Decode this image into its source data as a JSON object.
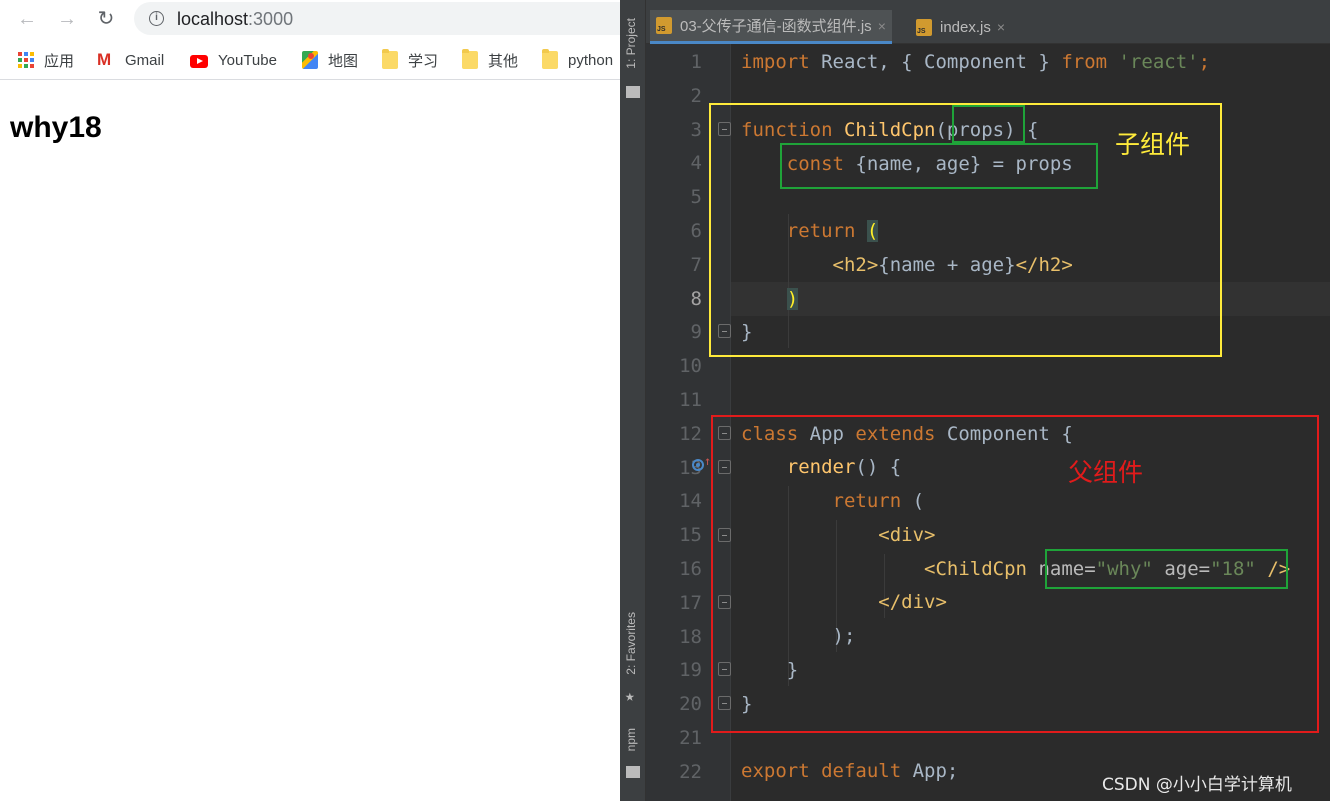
{
  "browser": {
    "nav": {
      "back_icon": "←",
      "forward_icon": "→",
      "reload_icon": "↻"
    },
    "address": {
      "host": "localhost",
      "port": ":3000"
    },
    "bookmarks": [
      {
        "label": "应用",
        "icon": "apps-icon"
      },
      {
        "label": "Gmail",
        "icon": "gmail-icon"
      },
      {
        "label": "YouTube",
        "icon": "youtube-icon"
      },
      {
        "label": "地图",
        "icon": "maps-icon"
      },
      {
        "label": "学习",
        "icon": "folder-icon"
      },
      {
        "label": "其他",
        "icon": "folder-icon"
      },
      {
        "label": "python",
        "icon": "folder-icon"
      }
    ],
    "page_heading": "why18"
  },
  "ide": {
    "tool_windows": {
      "project": "1: Project",
      "favorites": "2: Favorites",
      "npm": "npm"
    },
    "tabs": [
      {
        "label": "03-父传子通信-函数式组件.js",
        "close": "×",
        "active": true
      },
      {
        "label": "index.js",
        "close": "×",
        "active": false
      }
    ],
    "current_line": 8,
    "line_numbers": [
      "1",
      "2",
      "3",
      "4",
      "5",
      "6",
      "7",
      "8",
      "9",
      "10",
      "11",
      "12",
      "13",
      "14",
      "15",
      "16",
      "17",
      "18",
      "19",
      "20",
      "21",
      "22"
    ],
    "code": {
      "l1": {
        "a": "import",
        "b": " React, { Component } ",
        "c": "from",
        "d": " ",
        "e": "'react'",
        "f": ";"
      },
      "l3": {
        "a": "function",
        "b": " ",
        "c": "ChildCpn",
        "d": "(props) {"
      },
      "l4": {
        "a": "    ",
        "b": "const",
        "c": " {name, age} = props"
      },
      "l6": {
        "a": "    ",
        "b": "return",
        "c": " ",
        "d": "("
      },
      "l7": {
        "a": "        ",
        "b": "<h2>",
        "c": "{name + age}",
        "d": "</h2>"
      },
      "l8": {
        "a": "    ",
        "b": ")"
      },
      "l9": {
        "a": "}"
      },
      "l12": {
        "a": "class",
        "b": " App ",
        "c": "extends",
        "d": " Component {"
      },
      "l13": {
        "a": "    ",
        "b": "render",
        "c": "() {"
      },
      "l14": {
        "a": "        ",
        "b": "return",
        "c": " ("
      },
      "l15": {
        "a": "            ",
        "b": "<div>"
      },
      "l16": {
        "a": "                ",
        "b": "<ChildCpn",
        "c": " ",
        "d": "name",
        "e": "=",
        "f": "\"why\"",
        "g": " ",
        "h": "age",
        "i": "=",
        "j": "\"18\"",
        "k": " ",
        "l": "/>"
      },
      "l17": {
        "a": "            ",
        "b": "</div>"
      },
      "l18": {
        "a": "        ",
        "b": ");"
      },
      "l19": {
        "a": "    ",
        "b": "}"
      },
      "l20": {
        "a": "}"
      },
      "l22": {
        "a": "export",
        "b": " ",
        "c": "default",
        "d": " App;"
      }
    },
    "annotations": {
      "child_label": "子组件",
      "parent_label": "父组件"
    },
    "colors": {
      "child_box": "#ffeb3b",
      "parent_box": "#e11b1b",
      "highlight_box": "#1fa339"
    }
  },
  "watermark": "CSDN @小小白学计算机"
}
